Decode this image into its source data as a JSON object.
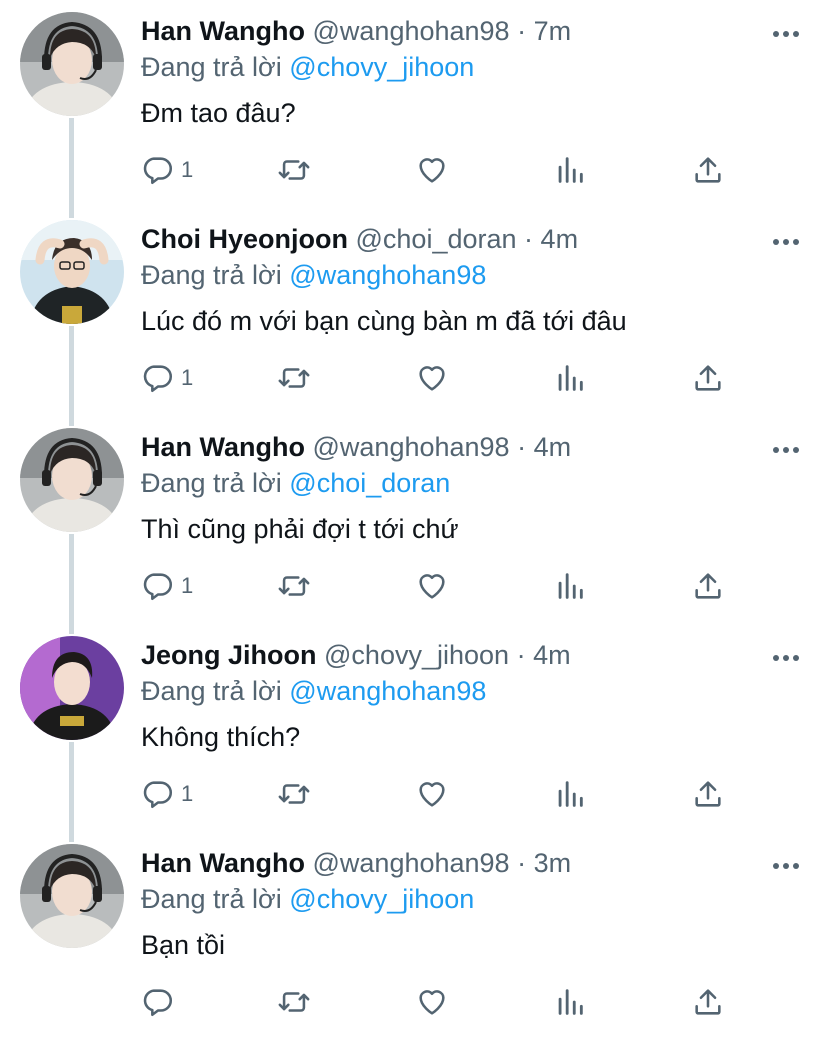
{
  "replying_prefix": "Đang trả lời",
  "tweets": [
    {
      "name": "Han Wangho",
      "handle": "@wanghohan98",
      "dot": "·",
      "time": "7m",
      "replying_to": "@chovy_jihoon",
      "text": "Đm tao đâu?",
      "reply_count": "1",
      "avatar": "han"
    },
    {
      "name": "Choi Hyeonjoon",
      "handle": "@choi_doran",
      "dot": "·",
      "time": "4m",
      "replying_to": "@wanghohan98",
      "text": "Lúc đó m với bạn cùng bàn m đã tới đâu",
      "reply_count": "1",
      "avatar": "choi"
    },
    {
      "name": "Han Wangho",
      "handle": "@wanghohan98",
      "dot": "·",
      "time": "4m",
      "replying_to": "@choi_doran",
      "text": "Thì cũng phải đợi t tới chứ",
      "reply_count": "1",
      "avatar": "han"
    },
    {
      "name": "Jeong Jihoon",
      "handle": "@chovy_jihoon",
      "dot": "·",
      "time": "4m",
      "replying_to": "@wanghohan98",
      "text": "Không thích?",
      "reply_count": "1",
      "avatar": "jeong"
    },
    {
      "name": "Han Wangho",
      "handle": "@wanghohan98",
      "dot": "·",
      "time": "3m",
      "replying_to": "@chovy_jihoon",
      "text": "Bạn tồi",
      "reply_count": "",
      "avatar": "han"
    }
  ],
  "colors": {
    "accent": "#1d9bf0",
    "secondary_text": "#536471",
    "thread_line": "#cfd9de"
  },
  "icons": [
    "more-icon",
    "reply-icon",
    "retweet-icon",
    "like-icon",
    "stats-icon",
    "share-icon"
  ]
}
